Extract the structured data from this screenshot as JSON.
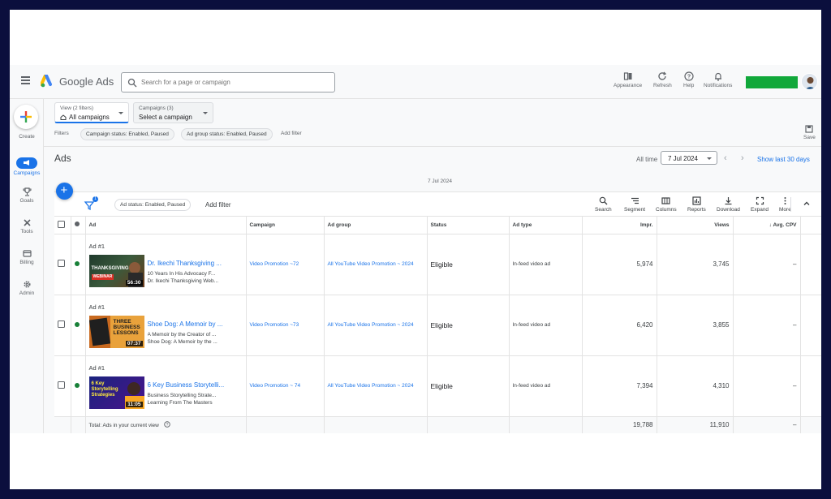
{
  "app": {
    "brand": "Google Ads"
  },
  "search": {
    "placeholder": "Search for a page or campaign"
  },
  "topbar": {
    "appearance": "Appearance",
    "refresh": "Refresh",
    "help": "Help",
    "notifications": "Notifications"
  },
  "nav": {
    "create": "Create",
    "campaigns": "Campaigns",
    "goals": "Goals",
    "tools": "Tools",
    "billing": "Billing",
    "admin": "Admin"
  },
  "view": {
    "label": "View (2 filters)",
    "value": "All campaigns"
  },
  "campaigns_select": {
    "label": "Campaigns (3)",
    "value": "Select a campaign"
  },
  "filters": {
    "label": "Filters",
    "chips": [
      "Campaign status: Enabled, Paused",
      "Ad group status: Enabled, Paused"
    ],
    "add": "Add filter",
    "save": "Save"
  },
  "page": {
    "title": "Ads",
    "all_time": "All time",
    "date": "7 Jul 2024",
    "show_last": "Show last 30 days",
    "date_center": "7 Jul 2024"
  },
  "toolbar": {
    "filter_count": "1",
    "status_chip": "Ad status: Enabled, Paused",
    "add_filter": "Add filter",
    "search": "Search",
    "segment": "Segment",
    "columns": "Columns",
    "reports": "Reports",
    "download": "Download",
    "expand": "Expand",
    "more": "More"
  },
  "table": {
    "headers": {
      "ad": "Ad",
      "campaign": "Campaign",
      "ad_group": "Ad group",
      "status": "Status",
      "ad_type": "Ad type",
      "impr": "Impr.",
      "views": "Views",
      "avg_cpv": "Avg. CPV"
    },
    "rows": [
      {
        "label": "Ad #1",
        "title": "Dr. Ikechi Thanksgiving ...",
        "line1": "10 Years In His Advocacy F...",
        "line2": "Dr. Ikechi Thanksgiving Web...",
        "thumb_text": "THANKSGIVING",
        "thumb_sub": "WEBINAR",
        "duration": "56:30",
        "campaign": "Video Promotion ~72",
        "ad_group": "All YouTube Video Promotion ~ 2024",
        "status": "Eligible",
        "ad_type": "In-feed video ad",
        "impr": "5,974",
        "views": "3,745",
        "avg_cpv": "–"
      },
      {
        "label": "Ad #1",
        "title": "Shoe Dog: A Memoir by ...",
        "line1": "A Memoir by the Creator of ...",
        "line2": "Shoe Dog: A Memoir by the ...",
        "thumb_text": "THREE BUSINESS LESSONS",
        "thumb_sub": "",
        "duration": "07:37",
        "campaign": "Video Promotion ~73",
        "ad_group": "All YouTube Video Promotion ~ 2024",
        "status": "Eligible",
        "ad_type": "In-feed video ad",
        "impr": "6,420",
        "views": "3,855",
        "avg_cpv": "–"
      },
      {
        "label": "Ad #1",
        "title": "6 Key Business Storytelli...",
        "line1": "Business Storytelling Strate...",
        "line2": "Learning From The Masters",
        "thumb_text": "6 Key Storytelling Strategies",
        "thumb_sub": "",
        "duration": "11:05",
        "campaign": "Video Promotion ~ 74",
        "ad_group": "All YouTube Video Promotion ~ 2024",
        "status": "Eligible",
        "ad_type": "In-feed video ad",
        "impr": "7,394",
        "views": "4,310",
        "avg_cpv": "–"
      }
    ],
    "total": {
      "label": "Total: Ads in your current view",
      "impr": "19,788",
      "views": "11,910",
      "avg_cpv": "–"
    }
  },
  "colors": {
    "accent": "#1a73e8",
    "enabled_dot": "#188038",
    "green_block": "#11a83a",
    "frame": "#0b0f3d"
  }
}
